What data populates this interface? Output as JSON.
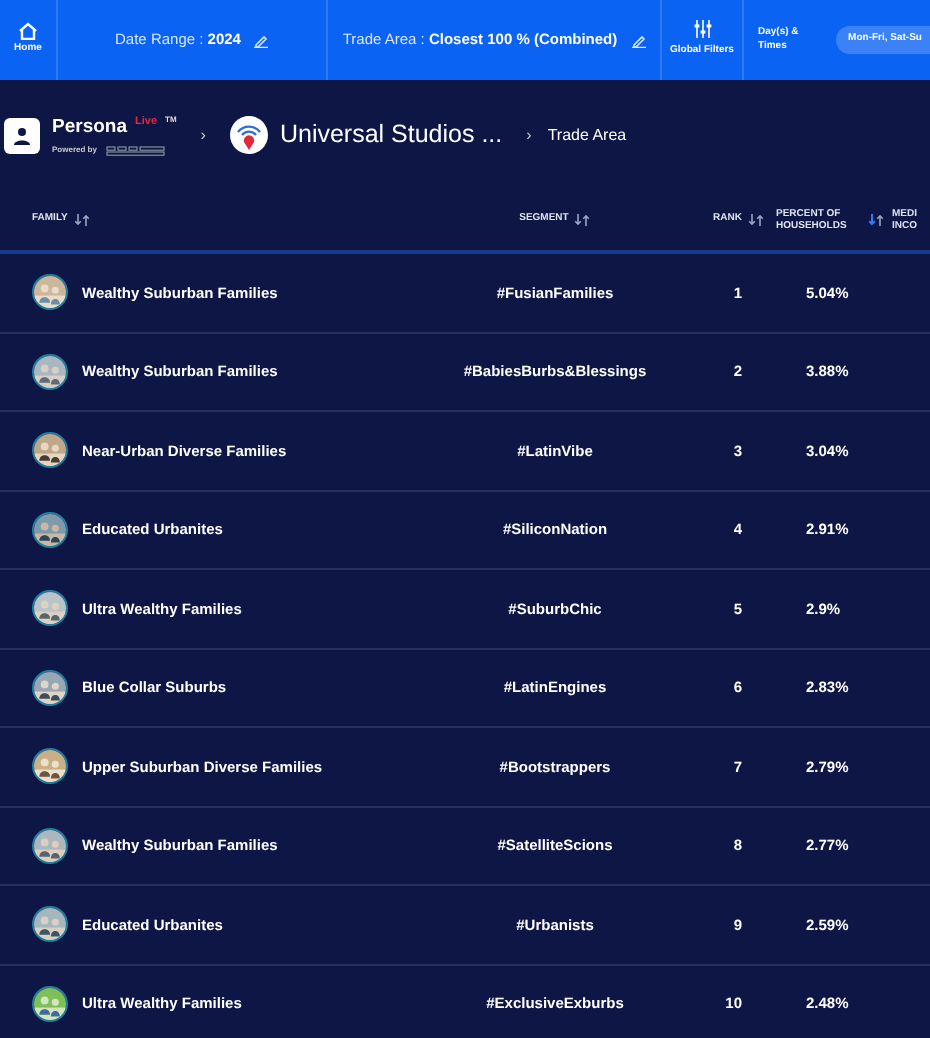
{
  "top_bar": {
    "home": {
      "label": "Home"
    },
    "date_range": {
      "label": "Date Range :",
      "value": "2024"
    },
    "trade_area": {
      "label": "Trade Area :",
      "value": "Closest 100 % (Combined)"
    },
    "global_filters": {
      "label": "Global Filters"
    },
    "days_times": {
      "label": "Day(s) & Times",
      "value": "Mon-Fri, Sat-Su"
    }
  },
  "breadcrumb": {
    "brand": "Persona",
    "badge": "Live",
    "trademark": "TM",
    "powered_by": "Powered by",
    "separators": [
      "›",
      "›"
    ],
    "location": "Universal Studios ...",
    "page": "Trade Area"
  },
  "table": {
    "columns": [
      {
        "label": "FAMILY",
        "sort_active": false
      },
      {
        "label": "SEGMENT",
        "sort_active": false
      },
      {
        "label": "RANK",
        "sort_active": false
      },
      {
        "label": "PERCENT OF HOUSEHOLDS",
        "sort_active": true
      },
      {
        "label": "MEDI INCO"
      }
    ],
    "rows": [
      {
        "family": "Wealthy Suburban Families",
        "segment": "#FusianFamilies",
        "rank": "1",
        "percent": "5.04%"
      },
      {
        "family": "Wealthy Suburban Families",
        "segment": "#BabiesBurbs&Blessings",
        "rank": "2",
        "percent": "3.88%"
      },
      {
        "family": "Near-Urban Diverse Families",
        "segment": "#LatinVibe",
        "rank": "3",
        "percent": "3.04%"
      },
      {
        "family": "Educated Urbanites",
        "segment": "#SiliconNation",
        "rank": "4",
        "percent": "2.91%"
      },
      {
        "family": "Ultra Wealthy Families",
        "segment": "#SuburbChic",
        "rank": "5",
        "percent": "2.9%"
      },
      {
        "family": "Blue Collar Suburbs",
        "segment": "#LatinEngines",
        "rank": "6",
        "percent": "2.83%"
      },
      {
        "family": "Upper Suburban Diverse Families",
        "segment": "#Bootstrappers",
        "rank": "7",
        "percent": "2.79%"
      },
      {
        "family": "Wealthy Suburban Families",
        "segment": "#SatelliteScions",
        "rank": "8",
        "percent": "2.77%"
      },
      {
        "family": "Educated Urbanites",
        "segment": "#Urbanists",
        "rank": "9",
        "percent": "2.59%"
      },
      {
        "family": "Ultra Wealthy Families",
        "segment": "#ExclusiveExburbs",
        "rank": "10",
        "percent": "2.48%"
      }
    ]
  }
}
